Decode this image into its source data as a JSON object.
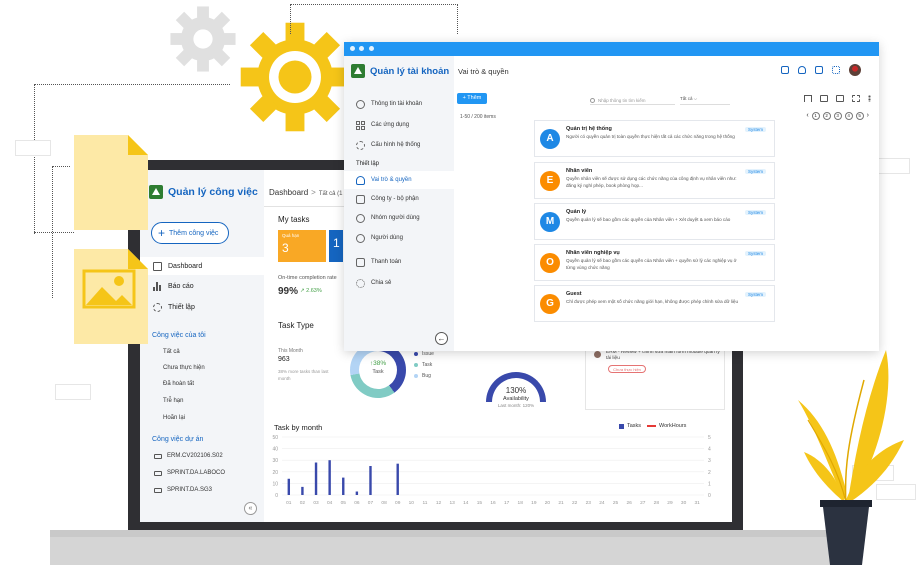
{
  "back_app": {
    "logo_text": "Quản lý công việc",
    "add_button": "Thêm công việc",
    "nav": [
      {
        "label": "Dashboard",
        "icon": "dashboard-icon"
      },
      {
        "label": "Báo cáo",
        "icon": "bar-chart-icon"
      },
      {
        "label": "Thiết lập",
        "icon": "gear-icon"
      }
    ],
    "my_work_title": "Công việc của tôi",
    "my_work_items": [
      "Tất cả",
      "Chưa thực hiện",
      "Đã hoàn tất",
      "Trễ hạn",
      "Hoãn lại"
    ],
    "projects_title": "Công việc dự án",
    "projects": [
      "ERM.CV202106.S02",
      "SPRINT.DA.LABOCO",
      "SPRINT.DA.SG3"
    ],
    "collapse_icon": "«",
    "breadcrumb": {
      "root": "Dashboard",
      "sep": ">",
      "current": "Tất cả (1"
    },
    "my_tasks_title": "My tasks",
    "task_cards": [
      {
        "label": "Quá hạn",
        "value": "3",
        "color": "#f9a825"
      },
      {
        "label": "",
        "value": "1",
        "color": "#1565c0"
      }
    ],
    "ontime_label": "On-time completion rate",
    "ontime_value": "99%",
    "ontime_change": "↗ 2.63%",
    "task_type_title": "Task Type",
    "this_month_label": "This Month",
    "this_month_value": "963",
    "this_month_note": "38% more tasks than last month",
    "donut_pct": "↑38%",
    "donut_caption": "Task",
    "donut_legend": [
      {
        "label": "Issue",
        "color": "#3949ab"
      },
      {
        "label": "Task",
        "color": "#80cbc4"
      },
      {
        "label": "Bug",
        "color": "#b3d4f5"
      }
    ],
    "gauge_value": "130%",
    "gauge_label": "Availability",
    "gauge_sub": "Last month: 120%",
    "erm_card_text": "ERM - Review + chỉnh sửa main form module quản lý tài liệu",
    "erm_card_button": "Chưa thực hiện",
    "task_by_month_title": "Task by month",
    "task_by_month_legend": {
      "tasks": "Tasks",
      "workhours": "WorkHours"
    }
  },
  "chart_data": {
    "type": "bar",
    "title": "Task by month",
    "categories": [
      "01",
      "02",
      "03",
      "04",
      "05",
      "06",
      "07",
      "08",
      "09",
      "10",
      "11",
      "12",
      "13",
      "14",
      "15",
      "16",
      "17",
      "18",
      "19",
      "20",
      "21",
      "22",
      "23",
      "24",
      "25",
      "26",
      "27",
      "28",
      "29",
      "30",
      "31"
    ],
    "series": [
      {
        "name": "Tasks",
        "color": "#3949ab",
        "values": [
          14,
          7,
          28,
          30,
          15,
          3,
          25,
          0,
          27,
          0,
          0,
          0,
          0,
          0,
          0,
          0,
          0,
          0,
          0,
          0,
          0,
          0,
          0,
          0,
          0,
          0,
          0,
          0,
          0,
          0,
          0
        ]
      },
      {
        "name": "WorkHours",
        "color": "#e53935",
        "values": []
      }
    ],
    "y_left_ticks": [
      "50",
      "40",
      "30",
      "20",
      "10",
      "0"
    ],
    "y_right_ticks": [
      "5",
      "4",
      "3",
      "2",
      "1",
      "0"
    ],
    "ylim": [
      0,
      50
    ]
  },
  "front_app": {
    "logo_text": "Quản lý tài khoản",
    "nav_top": [
      {
        "label": "Thông tin tài khoản",
        "icon": "user-circle-icon"
      },
      {
        "label": "Các ứng dụng",
        "icon": "apps-grid-icon"
      },
      {
        "label": "Cấu hình hệ thống",
        "icon": "gear-icon"
      }
    ],
    "section_title": "Thiết lập",
    "nav_setup": [
      {
        "label": "Vai trò & quyền",
        "icon": "role-icon",
        "active": true
      },
      {
        "label": "Công ty - bộ phận",
        "icon": "building-icon"
      },
      {
        "label": "Nhóm người dùng",
        "icon": "users-group-icon"
      },
      {
        "label": "Người dùng",
        "icon": "user-icon"
      },
      {
        "label": "Thanh toán",
        "icon": "payment-icon"
      },
      {
        "label": "Chia sẻ",
        "icon": "share-icon"
      }
    ],
    "back_icon": "←",
    "page_title": "Vai trò & quyền",
    "add_button": "+ Thêm",
    "search_placeholder": "Nhập thông tin tìm kiếm",
    "filter_value": "Tất cả  ⌵",
    "count_text": "1-50 / 200 items",
    "pager": {
      "prev": "‹",
      "pages": [
        "1",
        "2",
        "3",
        "4",
        "5"
      ],
      "next": "›"
    },
    "roles": [
      {
        "letter": "A",
        "name": "Quản trị hệ thống",
        "desc": "Người có quyền quản trị toàn quyền thực hiện tất cả các chức năng trong hệ thống",
        "tag": "System",
        "color": "#1e88e5"
      },
      {
        "letter": "E",
        "name": "Nhân viên",
        "desc": "Quyền nhân viên sẽ được sử dụng các chức năng của công định vụ nhân viên như: đăng ký nghỉ phép, book phòng họp...",
        "tag": "System",
        "color": "#fb8c00"
      },
      {
        "letter": "M",
        "name": "Quản lý",
        "desc": "Quyền quản lý sẽ bao gồm các quyền của Nhân viên + Xét duyệt & xem báo cáo",
        "tag": "System",
        "color": "#1e88e5"
      },
      {
        "letter": "O",
        "name": "Nhân viên nghiệp vụ",
        "desc": "Quyền quản lý sẽ bao gồm các quyền của Nhân viên + quyền sử lý các nghiệp vụ ở từng vùng chức năng",
        "tag": "System",
        "color": "#fb8c00"
      },
      {
        "letter": "G",
        "name": "Guest",
        "desc": "Chỉ được phép xem một số chức năng giới hạn, không được phép chỉnh sửa dữ liệu",
        "tag": "System",
        "color": "#fb8c00"
      }
    ]
  }
}
